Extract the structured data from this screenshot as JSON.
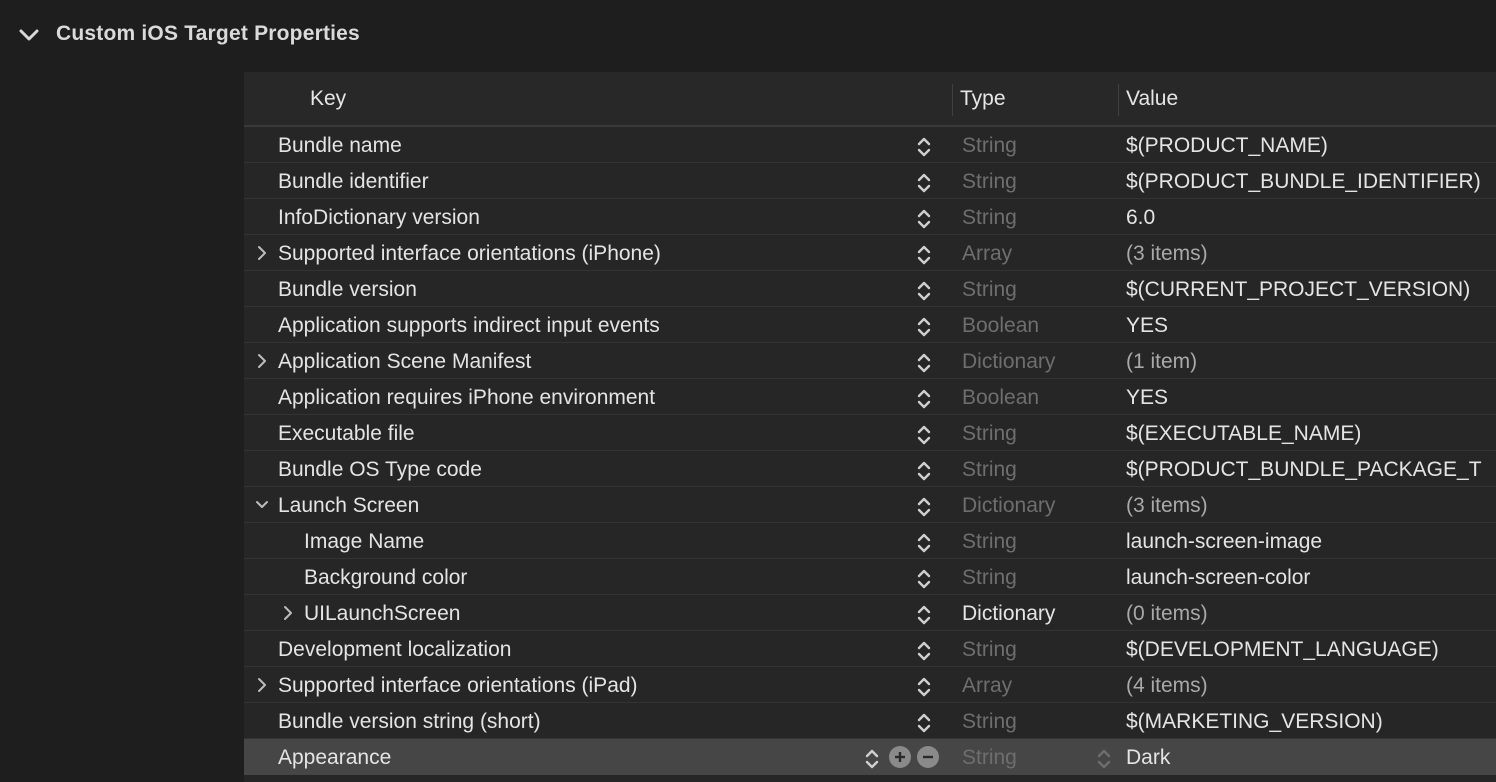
{
  "section": {
    "title": "Custom iOS Target Properties"
  },
  "columns": {
    "key": "Key",
    "type": "Type",
    "value": "Value"
  },
  "rows": [
    {
      "key": "Bundle name",
      "type": "String",
      "value": "$(PRODUCT_NAME)",
      "indent": 0,
      "disclosure": "none"
    },
    {
      "key": "Bundle identifier",
      "type": "String",
      "value": "$(PRODUCT_BUNDLE_IDENTIFIER)",
      "indent": 0,
      "disclosure": "none"
    },
    {
      "key": "InfoDictionary version",
      "type": "String",
      "value": "6.0",
      "indent": 0,
      "disclosure": "none"
    },
    {
      "key": "Supported interface orientations (iPhone)",
      "type": "Array",
      "value": "(3 items)",
      "indent": 0,
      "disclosure": "collapsed"
    },
    {
      "key": "Bundle version",
      "type": "String",
      "value": "$(CURRENT_PROJECT_VERSION)",
      "indent": 0,
      "disclosure": "none"
    },
    {
      "key": "Application supports indirect input events",
      "type": "Boolean",
      "value": "YES",
      "indent": 0,
      "disclosure": "none"
    },
    {
      "key": "Application Scene Manifest",
      "type": "Dictionary",
      "value": "(1 item)",
      "indent": 0,
      "disclosure": "collapsed"
    },
    {
      "key": "Application requires iPhone environment",
      "type": "Boolean",
      "value": "YES",
      "indent": 0,
      "disclosure": "none"
    },
    {
      "key": "Executable file",
      "type": "String",
      "value": "$(EXECUTABLE_NAME)",
      "indent": 0,
      "disclosure": "none"
    },
    {
      "key": "Bundle OS Type code",
      "type": "String",
      "value": "$(PRODUCT_BUNDLE_PACKAGE_T",
      "indent": 0,
      "disclosure": "none"
    },
    {
      "key": "Launch Screen",
      "type": "Dictionary",
      "value": "(3 items)",
      "indent": 0,
      "disclosure": "expanded"
    },
    {
      "key": "Image Name",
      "type": "String",
      "value": "launch-screen-image",
      "indent": 1,
      "disclosure": "none"
    },
    {
      "key": "Background color",
      "type": "String",
      "value": "launch-screen-color",
      "indent": 1,
      "disclosure": "none"
    },
    {
      "key": "UILaunchScreen",
      "type": "Dictionary",
      "value": "(0 items)",
      "indent": 1,
      "disclosure": "collapsed",
      "type_strong": true
    },
    {
      "key": "Development localization",
      "type": "String",
      "value": "$(DEVELOPMENT_LANGUAGE)",
      "indent": 0,
      "disclosure": "none"
    },
    {
      "key": "Supported interface orientations (iPad)",
      "type": "Array",
      "value": "(4 items)",
      "indent": 0,
      "disclosure": "collapsed"
    },
    {
      "key": "Bundle version string (short)",
      "type": "String",
      "value": "$(MARKETING_VERSION)",
      "indent": 0,
      "disclosure": "none"
    },
    {
      "key": "Appearance",
      "type": "String",
      "value": "Dark",
      "indent": 0,
      "disclosure": "none",
      "selected": true
    }
  ],
  "icons": {
    "section_chevron": "chevron-down-icon",
    "collapsed": "chevron-right-icon",
    "expanded": "chevron-down-icon",
    "stepper": "up-down-chevron-icon",
    "add": "plus-circle-icon",
    "remove": "minus-circle-icon"
  },
  "colors": {
    "background": "#1e1e1e",
    "table_background": "#262626",
    "selected_row": "#464646",
    "type_muted": "#6e6e6e"
  }
}
